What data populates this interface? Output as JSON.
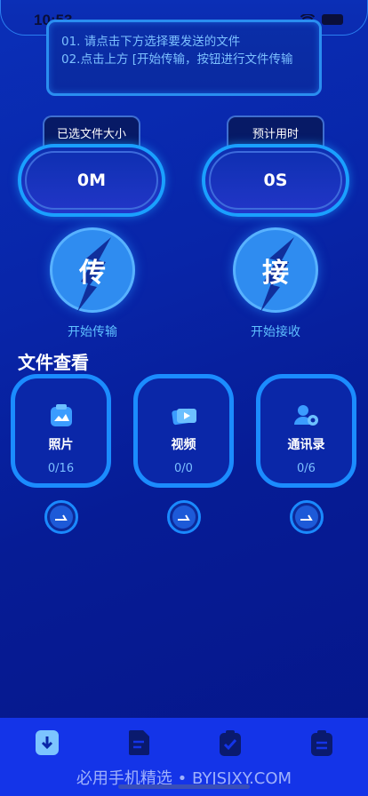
{
  "status": {
    "time": "10:53"
  },
  "notice": {
    "line1": "01. 请点击下方选择要发送的文件",
    "line2": "02.点击上方 [开始传输，按钮进行文件传输"
  },
  "stats": [
    {
      "label": "已选文件大小",
      "value": "0M"
    },
    {
      "label": "预计用时",
      "value": "0S"
    }
  ],
  "actions": [
    {
      "glyph": "传",
      "label": "开始传输"
    },
    {
      "glyph": "接",
      "label": "开始接收"
    }
  ],
  "section_title": "文件查看",
  "cards": [
    {
      "name": "照片",
      "count": "0/16",
      "icon": "photo-icon"
    },
    {
      "name": "视频",
      "count": "0/0",
      "icon": "video-icon"
    },
    {
      "name": "通讯录",
      "count": "0/6",
      "icon": "contacts-icon"
    }
  ],
  "tabs": [
    {
      "icon": "download-doc-icon",
      "active": true
    },
    {
      "icon": "document-icon",
      "active": false
    },
    {
      "icon": "clipboard-check-icon",
      "active": false
    },
    {
      "icon": "clipboard-list-icon",
      "active": false
    }
  ],
  "watermark": "必用手机精选 • BYJSJXY.COM",
  "colors": {
    "accent": "#1b8cff",
    "background": "#0825a8",
    "tabbar": "#1434e8",
    "notice_text": "#7cc0ff"
  }
}
